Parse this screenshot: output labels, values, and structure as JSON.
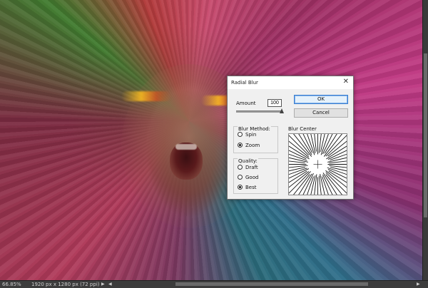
{
  "dialog": {
    "title": "Radial Blur",
    "amount_label": "Amount",
    "amount_value": "100",
    "amount_slider_fraction": 1.0,
    "ok_label": "OK",
    "cancel_label": "Cancel",
    "blur_method": {
      "label": "Blur Method:",
      "options": [
        {
          "label": "Spin",
          "checked": false
        },
        {
          "label": "Zoom",
          "checked": true
        }
      ]
    },
    "quality": {
      "label": "Quality:",
      "options": [
        {
          "label": "Draft",
          "checked": false
        },
        {
          "label": "Good",
          "checked": false
        },
        {
          "label": "Best",
          "checked": true
        }
      ]
    },
    "blur_center_label": "Blur Center"
  },
  "statusbar": {
    "zoom": "66.85%",
    "doc_info": "1920 px x 1280 px (72 ppi)"
  },
  "icons": {
    "close": "close-icon",
    "status_arrow": "triangle-right-icon",
    "scroll_left": "triangle-left-icon",
    "scroll_right": "triangle-right-icon"
  },
  "colors": {
    "ok_border": "#3c7fd1",
    "dialog_bg": "#f0f0f0"
  }
}
